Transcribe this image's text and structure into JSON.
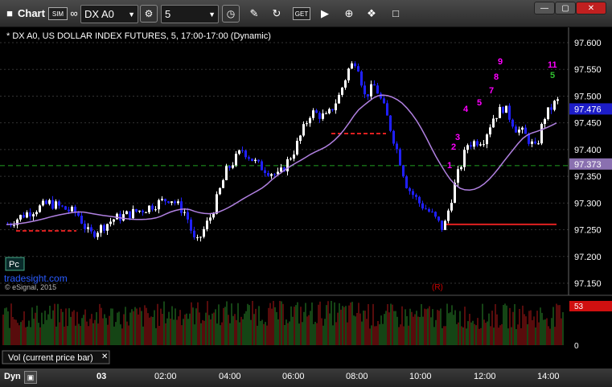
{
  "toolbar": {
    "app_label": "Chart",
    "sim_badge": "SIM",
    "symbol": "DX A0",
    "interval": "5",
    "icons": [
      "chart-icon",
      "link-icon",
      "gear-icon",
      "clock-icon",
      "pencil-icon",
      "refresh-icon",
      "get-icon",
      "play-icon",
      "tag-icon",
      "comment-icon"
    ]
  },
  "chart": {
    "title": "* DX A0, US DOLLAR INDEX FUTURES, 5, 17:00-17:00 (Dynamic)",
    "copyright": "© eSignal, 2015",
    "watermark_badge": "Pc",
    "watermark_url": "tradesight.com",
    "r_marker": "(R)",
    "price_labels": [
      "97.600",
      "97.550",
      "97.500",
      "97.450",
      "97.400",
      "97.350",
      "97.300",
      "97.250",
      "97.200",
      "97.150"
    ],
    "current_price_tag": "97.476",
    "ma_tag": "97.373",
    "time_labels": [
      "03",
      "02:00",
      "04:00",
      "06:00",
      "08:00",
      "10:00",
      "12:00",
      "14:00"
    ],
    "volume_tag": "53",
    "volume_zero": "0",
    "volume_label": "Vol (current price bar)",
    "colors": {
      "up": "#ffffff",
      "down": "#2020ff",
      "ma": "#b080e0",
      "setup": "#ff00ff",
      "count": "#30c030",
      "support": "#e02020",
      "dashed_green": "#20a020"
    }
  },
  "sequential_labels": {
    "buy_setup": [
      "1",
      "2",
      "3",
      "4",
      "5",
      "7",
      "8",
      "9"
    ],
    "top_counts": [
      "11",
      "5"
    ]
  },
  "statusbar": {
    "dyn_label": "Dyn"
  }
}
